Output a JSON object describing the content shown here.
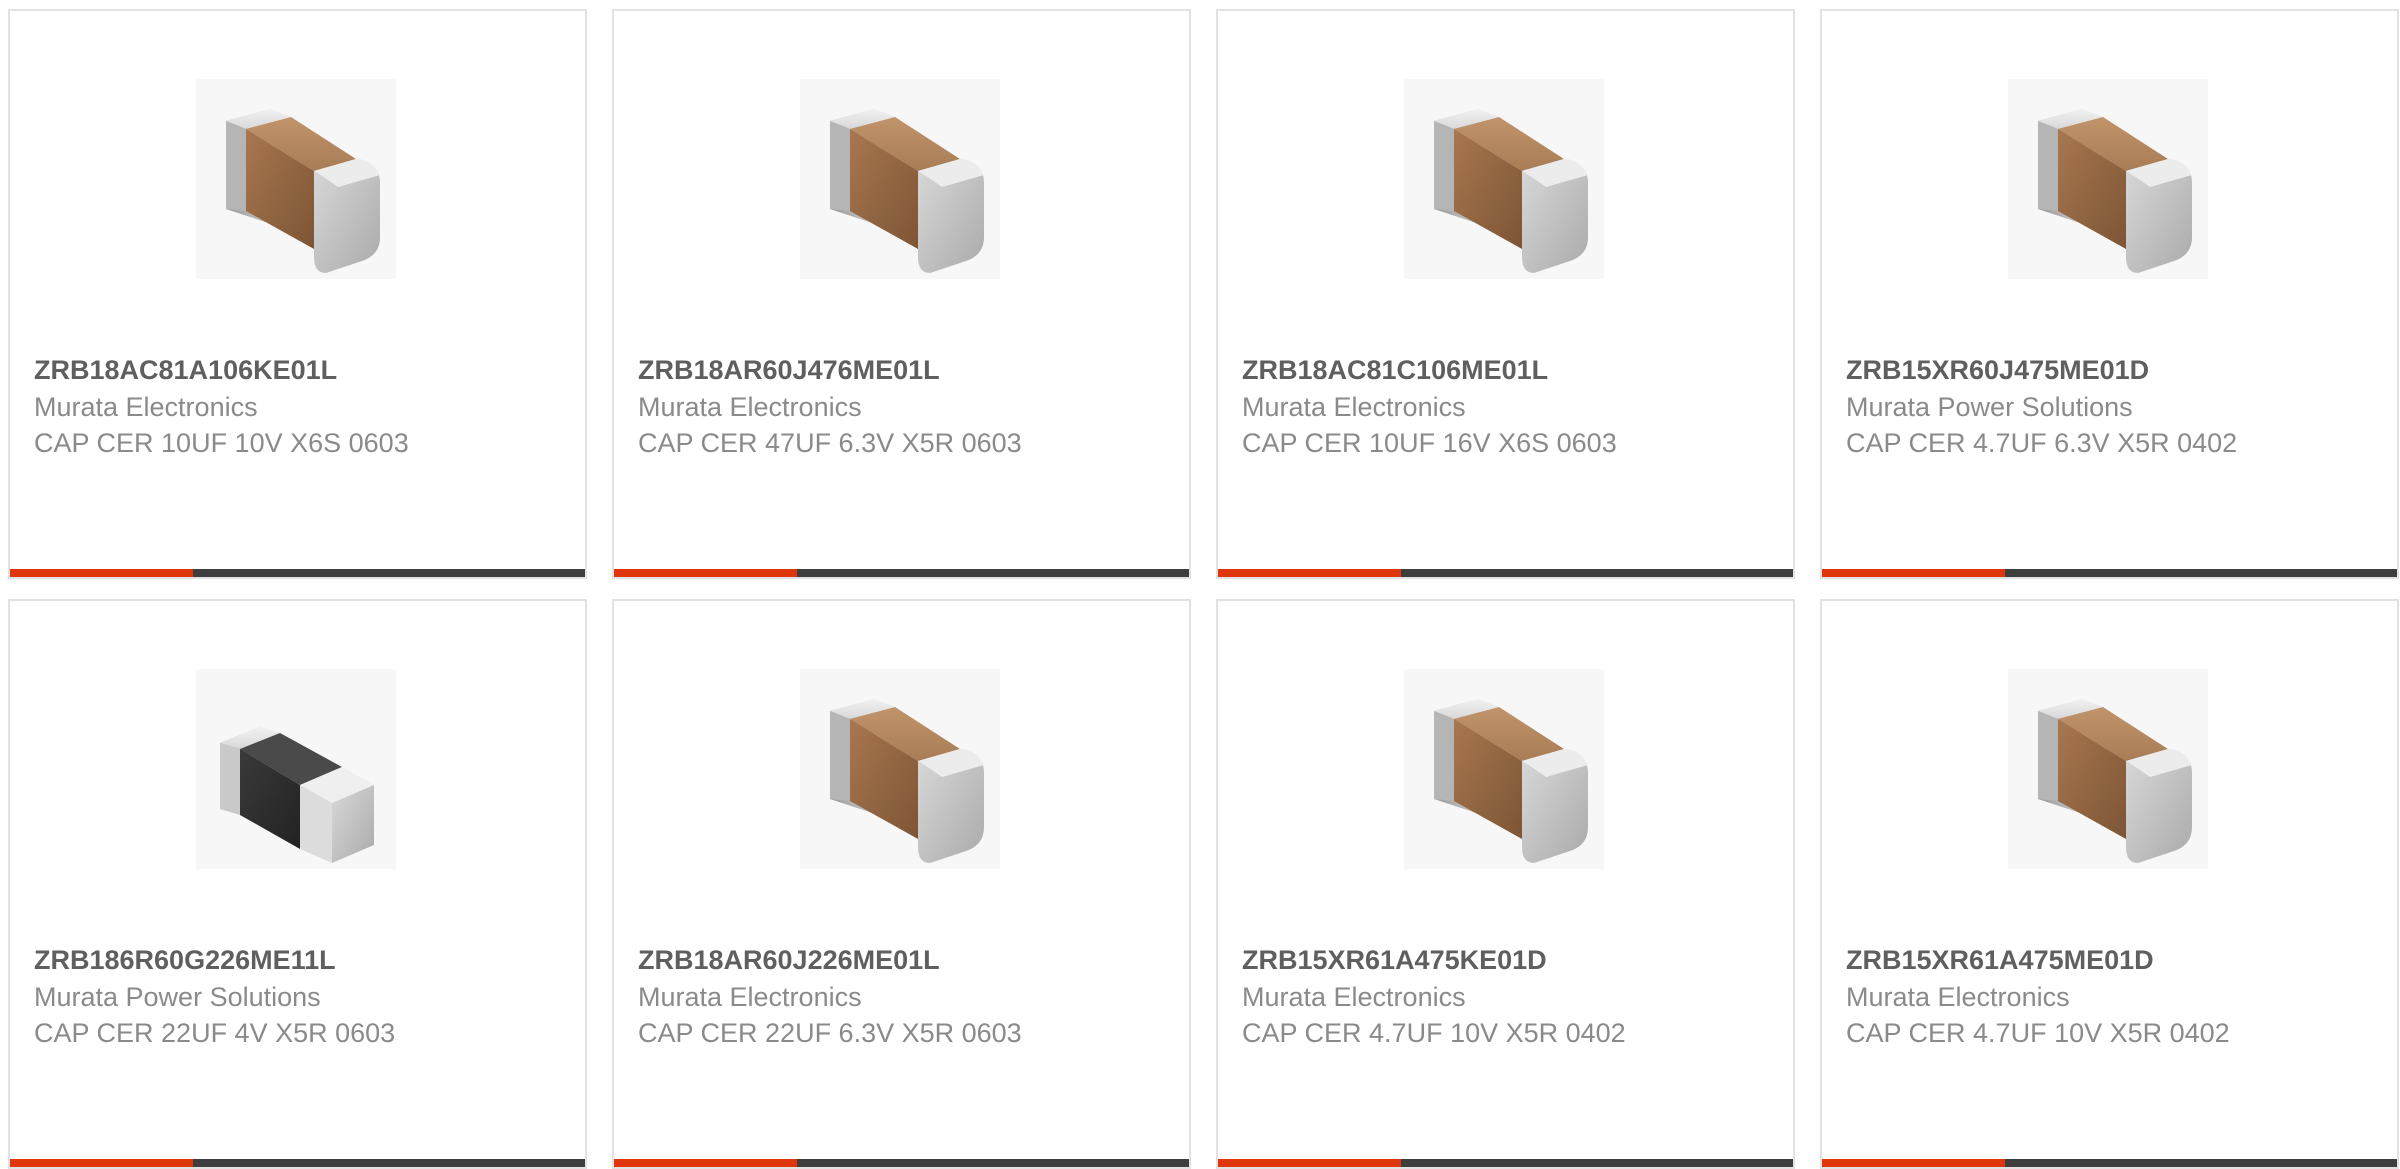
{
  "colors": {
    "accent": "#e0360c",
    "bar_dark": "#3e3e3e",
    "part_text": "#5f5f5f",
    "sub_text": "#8a8a8a",
    "card_border": "#e2e2e2"
  },
  "products": [
    {
      "part_number": "ZRB18AC81A106KE01L",
      "manufacturer": "Murata Electronics",
      "description": "CAP CER 10UF 10V X6S 0603",
      "image_icon": "capacitor-brown-icon"
    },
    {
      "part_number": "ZRB18AR60J476ME01L",
      "manufacturer": "Murata Electronics",
      "description": "CAP CER 47UF 6.3V X5R 0603",
      "image_icon": "capacitor-brown-icon"
    },
    {
      "part_number": "ZRB18AC81C106ME01L",
      "manufacturer": "Murata Electronics",
      "description": "CAP CER 10UF 16V X6S 0603",
      "image_icon": "capacitor-brown-icon"
    },
    {
      "part_number": "ZRB15XR60J475ME01D",
      "manufacturer": "Murata Power Solutions",
      "description": "CAP CER 4.7UF 6.3V X5R 0402",
      "image_icon": "capacitor-brown-icon"
    },
    {
      "part_number": "ZRB186R60G226ME11L",
      "manufacturer": "Murata Power Solutions",
      "description": "CAP CER 22UF 4V X5R 0603",
      "image_icon": "capacitor-black-icon"
    },
    {
      "part_number": "ZRB18AR60J226ME01L",
      "manufacturer": "Murata Electronics",
      "description": "CAP CER 22UF 6.3V X5R 0603",
      "image_icon": "capacitor-brown-icon"
    },
    {
      "part_number": "ZRB15XR61A475KE01D",
      "manufacturer": "Murata Electronics",
      "description": "CAP CER 4.7UF 10V X5R 0402",
      "image_icon": "capacitor-brown-icon"
    },
    {
      "part_number": "ZRB15XR61A475ME01D",
      "manufacturer": "Murata Electronics",
      "description": "CAP CER 4.7UF 10V X5R 0402",
      "image_icon": "capacitor-brown-icon"
    }
  ]
}
